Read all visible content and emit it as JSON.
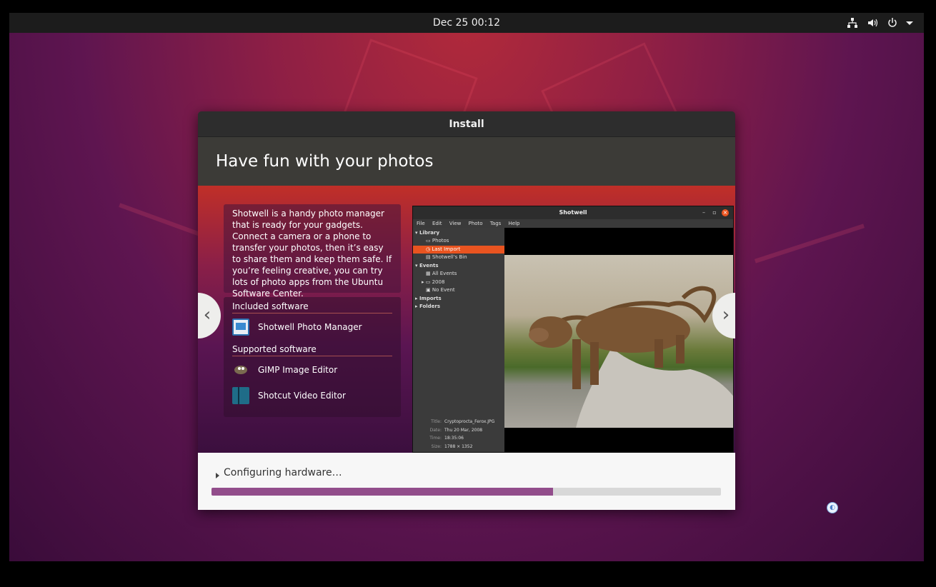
{
  "topbar": {
    "clock": "Dec 25  00:12",
    "icons": [
      "network-icon",
      "volume-icon",
      "power-icon",
      "menu-arrow-icon"
    ]
  },
  "window": {
    "title": "Install",
    "header": "Have fun with your photos"
  },
  "slide": {
    "description": "Shotwell is a handy photo manager that is ready for your gadgets. Connect a camera or a phone to transfer your photos, then it’s easy to share them and keep them safe. If you’re feeling creative, you can try lots of photo apps from the Ubuntu Software Center.",
    "included_title": "Included software",
    "included": [
      {
        "name": "Shotwell Photo Manager",
        "icon": "shotwell-icon"
      }
    ],
    "supported_title": "Supported software",
    "supported": [
      {
        "name": "GIMP Image Editor",
        "icon": "gimp-icon"
      },
      {
        "name": "Shotcut Video Editor",
        "icon": "shotcut-icon"
      }
    ],
    "nav_prev": "‹",
    "nav_next": "›"
  },
  "screenshot": {
    "title": "Shotwell",
    "menu": [
      "File",
      "Edit",
      "View",
      "Photo",
      "Tags",
      "Help"
    ],
    "sidebar": {
      "library": "Library",
      "photos": "Photos",
      "last_import": "Last Import",
      "bin": "Shotwell's Bin",
      "events": "Events",
      "all_events": "All Events",
      "year": "2008",
      "no_event": "No Event",
      "imports": "Imports",
      "folders": "Folders"
    },
    "meta": {
      "title_label": "Title:",
      "title": "Cryptoprocta_Ferox.JPG",
      "date_label": "Date:",
      "date": "Thu 20 Mar, 2008",
      "time_label": "Time:",
      "time": "18:35:06",
      "size_label": "Size:",
      "size": "1788 × 1352"
    }
  },
  "status": {
    "text": "Configuring hardware…",
    "progress_fraction": 0.67
  },
  "colors": {
    "accent": "#924d8b",
    "highlight": "#e95420"
  }
}
